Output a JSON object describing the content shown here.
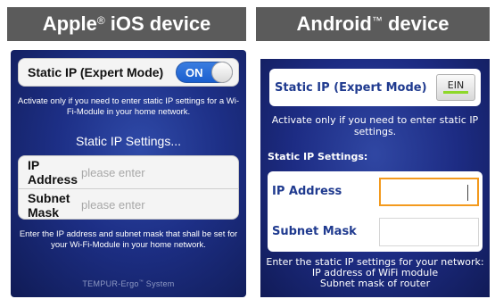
{
  "headers": {
    "ios": {
      "brand": "Apple",
      "mark": "®",
      "suffix": " iOS device"
    },
    "android": {
      "brand": "Android",
      "mark": "™",
      "suffix": " device"
    }
  },
  "ios": {
    "toggle_label": "Static IP (Expert Mode)",
    "toggle_state": "ON",
    "note_top": "Activate only if you need to enter static IP settings for a Wi-Fi-Module in your home network.",
    "section_title": "Static IP Settings...",
    "fields": [
      {
        "label": "IP Address",
        "placeholder": "please enter"
      },
      {
        "label": "Subnet Mask",
        "placeholder": "please enter"
      }
    ],
    "note_bottom": "Enter the IP address and subnet mask that shall be set for your Wi-Fi-Module in your home network.",
    "footer": {
      "brand": "TEMPUR-Ergo",
      "mark": "™",
      "suffix": " System"
    }
  },
  "android": {
    "toggle_label": "Static IP (Expert Mode)",
    "toggle_state": "EIN",
    "note_top": "Activate only if you need to enter static IP settings.",
    "section_title": "Static IP Settings:",
    "fields": [
      {
        "label": "IP Address",
        "value": ""
      },
      {
        "label": "Subnet Mask",
        "value": ""
      }
    ],
    "note_bottom_lines": [
      "Enter the static IP settings for your network:",
      "IP address of WiFi module",
      "Subnet mask of router"
    ]
  },
  "colors": {
    "header_bg": "#5b5b5b",
    "ios_switch": "#1b5fcf",
    "android_label": "#1f3a8f",
    "android_focus": "#f39a1e",
    "android_toggle_on": "#8ed82a"
  }
}
